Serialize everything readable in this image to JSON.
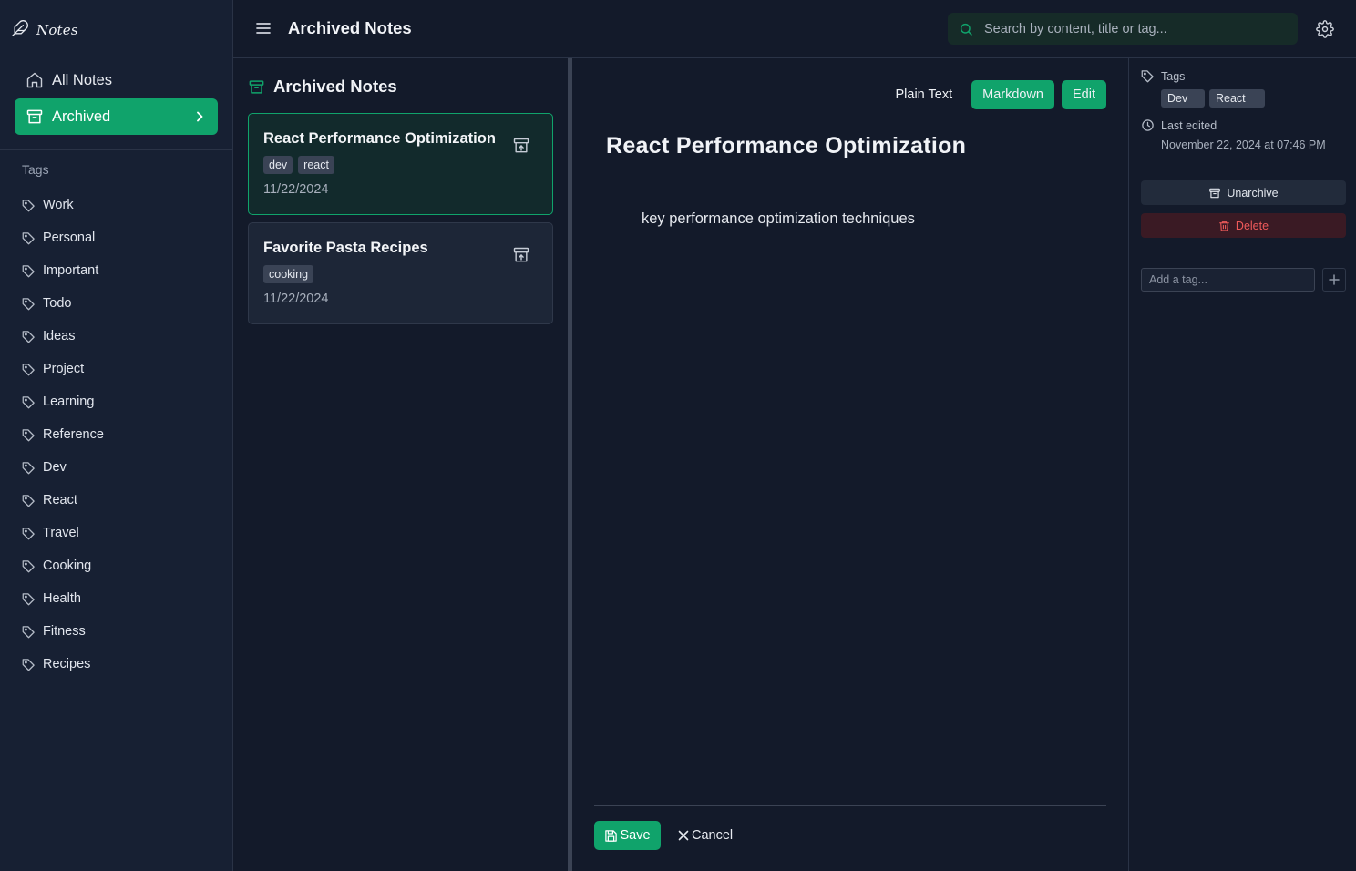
{
  "app": {
    "logo_text": "Notes"
  },
  "sidebar": {
    "nav": [
      {
        "label": "All Notes",
        "icon": "home-icon"
      },
      {
        "label": "Archived",
        "icon": "archive-icon",
        "active": true
      }
    ],
    "tags_heading": "Tags",
    "tags": [
      "Work",
      "Personal",
      "Important",
      "Todo",
      "Ideas",
      "Project",
      "Learning",
      "Reference",
      "Dev",
      "React",
      "Travel",
      "Cooking",
      "Health",
      "Fitness",
      "Recipes"
    ]
  },
  "header": {
    "title": "Archived Notes",
    "search_placeholder": "Search by content, title or tag..."
  },
  "list": {
    "title": "Archived Notes",
    "notes": [
      {
        "title": "React Performance Optimization",
        "tags": [
          "dev",
          "react"
        ],
        "date": "11/22/2024",
        "active": true
      },
      {
        "title": "Favorite Pasta Recipes",
        "tags": [
          "cooking"
        ],
        "date": "11/22/2024",
        "active": false
      }
    ]
  },
  "editor": {
    "modes": {
      "plain": "Plain Text",
      "markdown": "Markdown",
      "edit": "Edit"
    },
    "heading": "React Performance Optimization",
    "body": "key performance optimization techniques",
    "save_label": "Save",
    "cancel_label": "Cancel"
  },
  "details": {
    "tags_label": "Tags",
    "tags": [
      "Dev",
      "React"
    ],
    "last_edited_label": "Last edited",
    "last_edited_value": "November 22, 2024 at 07:46 PM",
    "unarchive_label": "Unarchive",
    "delete_label": "Delete",
    "add_tag_placeholder": "Add a tag..."
  },
  "colors": {
    "accent": "#10a36b",
    "background": "#131a2a",
    "sidebar": "#172033",
    "danger": "#ef5a5a"
  }
}
